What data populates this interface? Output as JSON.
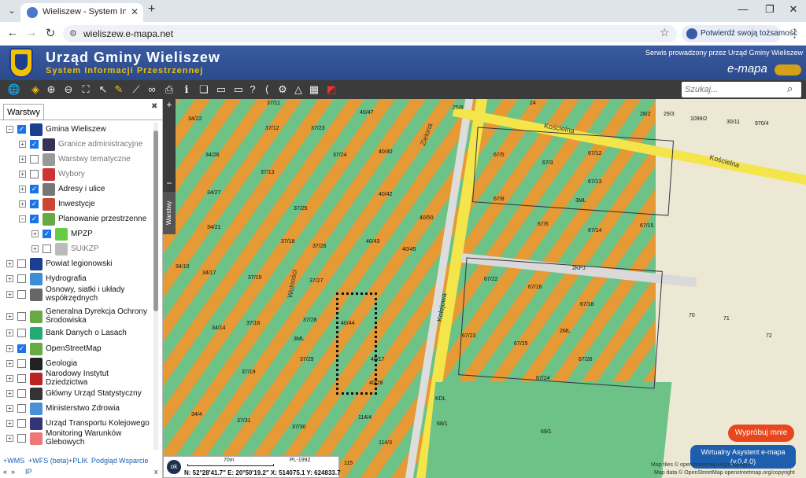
{
  "browser": {
    "tab_title": "Wieliszew - System Informacji P",
    "url": "wieliszew.e-mapa.net",
    "identity_button": "Potwierdź swoją tożsamość"
  },
  "header": {
    "title": "Urząd Gminy Wieliszew",
    "subtitle": "System Informacji Przestrzennej",
    "service_text": "Serwis prowadzony przez Urząd Gminy Wieliszew",
    "logo_text": "e-mapa"
  },
  "search": {
    "placeholder": "Szukaj..."
  },
  "sidebar": {
    "tab_label": "Warstwy",
    "layers": [
      {
        "label": "Gmina Wieliszew",
        "checked": true,
        "expander": "−"
      },
      {
        "label": "Granice administracyjne",
        "checked": true,
        "expander": "+",
        "dim": true
      },
      {
        "label": "Warstwy tematyczne",
        "checked": false,
        "expander": "+",
        "dim": true
      },
      {
        "label": "Wybory",
        "checked": false,
        "expander": "+",
        "dim": true
      },
      {
        "label": "Adresy i ulice",
        "checked": true,
        "expander": "+"
      },
      {
        "label": "Inwestycje",
        "checked": true,
        "expander": "+"
      },
      {
        "label": "Planowanie przestrzenne",
        "checked": true,
        "expander": "−"
      },
      {
        "label": "MPZP",
        "checked": true,
        "expander": "+"
      },
      {
        "label": "SUiKZP",
        "checked": false,
        "expander": "+",
        "dim": true
      },
      {
        "label": "Powiat legionowski",
        "checked": false,
        "expander": "+"
      },
      {
        "label": "Hydrografia",
        "checked": false,
        "expander": "+"
      },
      {
        "label": "Osnowy, siatki i układy współrzędnych",
        "checked": false,
        "expander": "+"
      },
      {
        "label": "Generalna Dyrekcja Ochrony Środowiska",
        "checked": false,
        "expander": "+"
      },
      {
        "label": "Bank Danych o Lasach",
        "checked": false,
        "expander": "+"
      },
      {
        "label": "OpenStreetMap",
        "checked": true,
        "expander": "+"
      },
      {
        "label": "Geologia",
        "checked": false,
        "expander": "+"
      },
      {
        "label": "Narodowy Instytut Dziedzictwa",
        "checked": false,
        "expander": "+"
      },
      {
        "label": "Główny Urząd Statystyczny",
        "checked": false,
        "expander": "+"
      },
      {
        "label": "Ministerstwo Zdrowia",
        "checked": false,
        "expander": "+"
      },
      {
        "label": "Urząd Transportu Kolejowego",
        "checked": false,
        "expander": "+"
      },
      {
        "label": "Monitoring Warunków Glebowych",
        "checked": false,
        "expander": "+"
      }
    ],
    "footer_links": [
      "+WMS",
      "+WFS (beta)",
      "+PLIK",
      "Podgląd",
      "Wsparcie"
    ],
    "footer_row2": [
      "«",
      "»",
      "IP"
    ],
    "footer_close": "x"
  },
  "map": {
    "streets": [
      "Kościelna",
      "Kościelna",
      "Wolności",
      "Kolejowa",
      "Zielona"
    ],
    "parcels": [
      "37/11",
      "34/22",
      "37/12",
      "37/23",
      "40/47",
      "25/8",
      "24",
      "28/2",
      "29/3",
      "1099/2",
      "30/11",
      "970/4",
      "34/26",
      "37/13",
      "37/24",
      "40/40",
      "67/5",
      "67/3",
      "67/12",
      "34/27",
      "37/25",
      "40/42",
      "67/13",
      "3ML",
      "34/21",
      "37/18",
      "37/26",
      "40/43",
      "40/50",
      "67/8",
      "67/6",
      "67/14",
      "67/15",
      "34/10",
      "34/17",
      "37/15",
      "37/27",
      "40/45",
      "2KPJ",
      "67/22",
      "67/16",
      "34/14",
      "37/16",
      "37/28",
      "40/44",
      "67/18",
      "70",
      "71",
      "3ML",
      "37/29",
      "40/17",
      "67/23",
      "67/25",
      "2ML",
      "72",
      "37/19",
      "40/28",
      "67/26",
      "37/30",
      "114/4",
      "67/24",
      "69/1",
      "34/4",
      "37/31",
      "114/3",
      "115",
      "KDL",
      "68/1"
    ],
    "crs": "PL-1992",
    "scale": "70m",
    "coordinates": "N: 52°28'41.7\" E: 20°50'19.2\" X: 514075.1 Y: 624833.7",
    "zoom_in": "+",
    "zoom_out": "−",
    "rail_tab": "Warstwy",
    "ok_label": "ok",
    "try_button": "Wypróbuj mnie",
    "assistant_button_line1": "Wirtualny Asystent e-mapa",
    "assistant_button_line2": "(v.0.4.0)",
    "attribution_1": "Map tiles © openstreetmap.org/copyright",
    "attribution_2": "Map data © OpenStreetMap openstreetmap.org/copyright"
  },
  "colors": {
    "header_bg": "#2b4a8c",
    "accent_yellow": "#f2c200",
    "mpzp_orange": "#e59a36",
    "mpzp_green": "#6cc287",
    "try_button": "#e8461c",
    "assistant_button": "#1d5fae"
  }
}
